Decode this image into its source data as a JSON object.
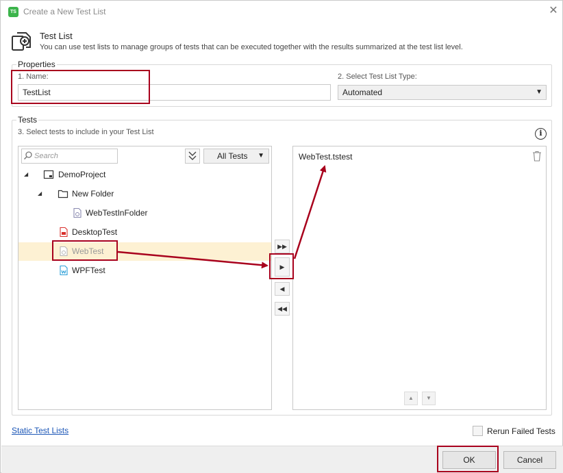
{
  "window": {
    "title": "Create a New Test List",
    "app_badge": "TS"
  },
  "header": {
    "title": "Test List",
    "description": "You can use test lists to manage groups of tests that can be executed together with the results summarized at the test list level."
  },
  "properties": {
    "group_label": "Properties",
    "name_label": "1. Name:",
    "name_value": "TestList",
    "type_label": "2.  Select Test List Type:",
    "type_value": "Automated"
  },
  "tests": {
    "group_label": "Tests",
    "instruction": "3.  Select tests to include in your Test List",
    "search_placeholder": "Search",
    "filter_label": "All Tests",
    "tree": [
      {
        "label": "DemoProject",
        "icon": "project-icon"
      },
      {
        "label": "New Folder",
        "icon": "folder-icon"
      },
      {
        "label": "WebTestInFolder",
        "icon": "web-test-icon"
      },
      {
        "label": "DesktopTest",
        "icon": "desktop-test-icon"
      },
      {
        "label": "WebTest",
        "icon": "web-test-icon"
      },
      {
        "label": "WPFTest",
        "icon": "wpf-test-icon"
      }
    ],
    "selected_item": "WebTest.tstest"
  },
  "footer": {
    "static_link": "Static Test Lists",
    "rerun_label": "Rerun Failed Tests",
    "ok_label": "OK",
    "cancel_label": "Cancel"
  },
  "colors": {
    "highlight": "#a8001c",
    "selected_row": "#fdf1d3",
    "link": "#1a55b6",
    "badge": "#3cb44b"
  }
}
